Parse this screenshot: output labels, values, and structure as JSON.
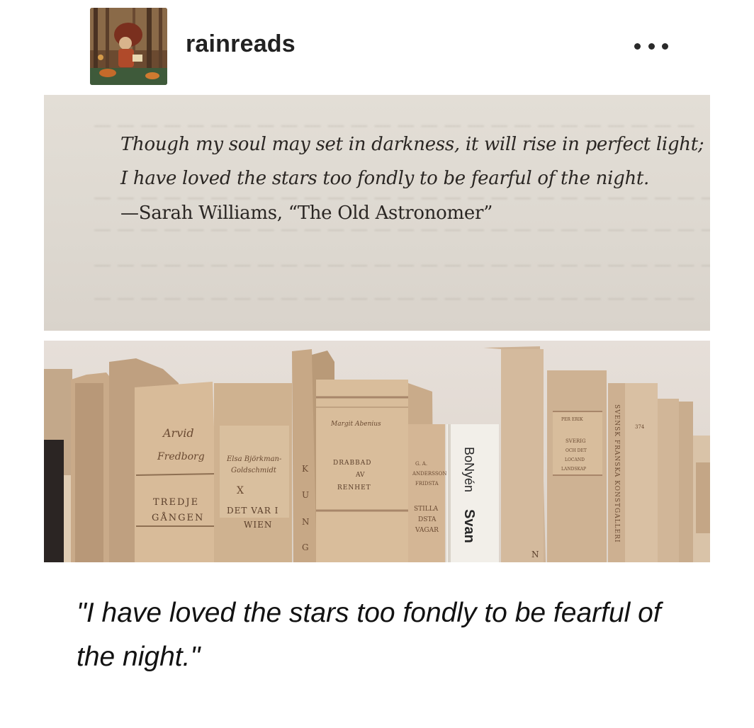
{
  "post": {
    "username": "rainreads",
    "more_icon": "more-horizontal-icon"
  },
  "quote_photo": {
    "line1": "Though my soul may set in darkness, it will rise in perfect light;",
    "line2": "I have loved the stars too fondly to be fearful of the night.",
    "attribution": "—Sarah Williams, “The Old Astronomer”"
  },
  "books_photo": {
    "spine1_author_first": "Arvid",
    "spine1_author_last": "Fredborg",
    "spine1_title_a": "TREDJE",
    "spine1_title_b": "GÅNGEN",
    "spine2_author_a": "Elsa Björkman-",
    "spine2_author_b": "Goldschmidt",
    "spine2_mark": "X",
    "spine2_title_a": "DET VAR I",
    "spine2_title_b": "WIEN",
    "spine3_letters": [
      "K",
      "U",
      "N",
      "G"
    ],
    "spine4_author": "Margit Abenius",
    "spine4_title_a": "DRABBAD",
    "spine4_title_b": "AV",
    "spine4_title_c": "RENHET",
    "spine5_top_a": "G. A.",
    "spine5_top_b": "ANDERSSON",
    "spine5_top_c": "FRIDSTA",
    "spine5_mid_a": "STILLA",
    "spine5_mid_b": "DSTA",
    "spine5_mid_c": "VAGAR",
    "spine6_publisher": "BoNyén",
    "spine6_title": "Svan",
    "spine7_letter": "N",
    "spine8_top": "PER ERIK",
    "spine8_a": "SVERIG",
    "spine8_b": "OCH DET",
    "spine8_c": "LOCAND",
    "spine8_d": "LANDSKAP",
    "spine9_text": "SVENSK FRANSKA KONSTGALLERI",
    "spine10_num": "374"
  },
  "caption": "\"I have loved the stars too fondly to be fearful of the night.\"",
  "colors": {
    "page_bg": "#ffffff",
    "paper": "#dfdad2",
    "ink": "#2a2623",
    "spine": "#d4b99d",
    "text": "#121212"
  }
}
